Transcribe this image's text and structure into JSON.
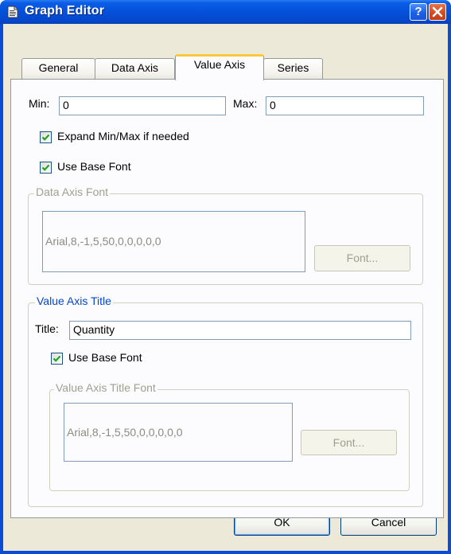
{
  "window": {
    "title": "Graph Editor",
    "help_label": "?",
    "close_label": "✕"
  },
  "tabs": [
    {
      "label": "General",
      "active": false
    },
    {
      "label": "Data Axis",
      "active": false
    },
    {
      "label": "Value Axis",
      "active": true
    },
    {
      "label": "Series",
      "active": false
    }
  ],
  "value_axis": {
    "min_label": "Min:",
    "min_value": "0",
    "max_label": "Max:",
    "max_value": "0",
    "expand_label": "Expand Min/Max if needed",
    "expand_checked": true,
    "use_base_font_label": "Use Base Font",
    "use_base_font_checked": true,
    "data_axis_font": {
      "legend": "Data Axis Font",
      "font_value": "Arial,8,-1,5,50,0,0,0,0,0",
      "font_button": "Font..."
    },
    "title_group": {
      "legend": "Value Axis Title",
      "title_label": "Title:",
      "title_value": "Quantity",
      "use_base_font_label": "Use Base Font",
      "use_base_font_checked": true,
      "title_font": {
        "legend": "Value Axis Title Font",
        "font_value": "Arial,8,-1,5,50,0,0,0,0,0",
        "font_button": "Font..."
      }
    }
  },
  "footer": {
    "ok_label": "OK",
    "cancel_label": "Cancel"
  },
  "colors": {
    "titlebar": "#0552dc",
    "dialog_face": "#ece9d8",
    "active_tab_accent": "#ffc83c",
    "group_title_blue": "#0046d5"
  }
}
